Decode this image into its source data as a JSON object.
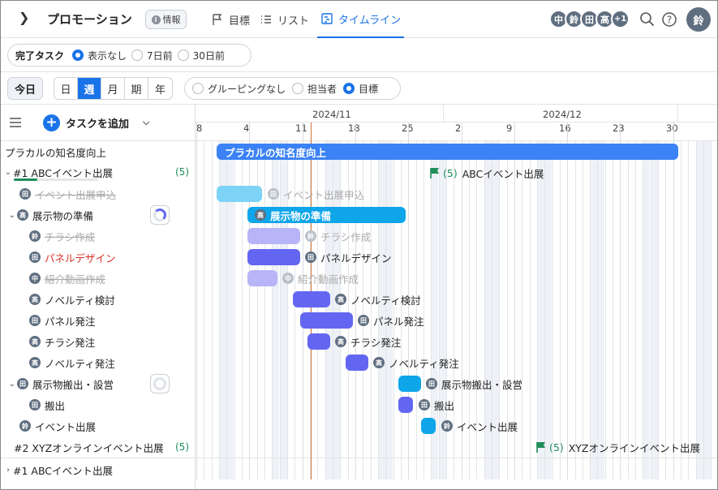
{
  "header": {
    "title": "プロモーション",
    "info_label": "情報",
    "tabs": [
      {
        "label": "目標",
        "icon": "flag-icon"
      },
      {
        "label": "リスト",
        "icon": "list-icon"
      },
      {
        "label": "タイムライン",
        "icon": "timeline-icon",
        "active": true
      }
    ],
    "avatars": [
      "中",
      "鈴",
      "田",
      "高",
      "+1"
    ],
    "user_avatar": "鈴"
  },
  "filters": {
    "completed_label": "完了タスク",
    "completed_options": [
      "表示なし",
      "7日前",
      "30日前"
    ],
    "completed_selected": "表示なし",
    "today_label": "今日",
    "scales": [
      "日",
      "週",
      "月",
      "期",
      "年"
    ],
    "scale_selected": "週",
    "grouping_options": [
      "グルーピングなし",
      "担当者",
      "目標"
    ],
    "grouping_selected": "目標"
  },
  "sidebar": {
    "add_task_label": "タスクを追加",
    "rows": [
      {
        "label": "プラカルの知名度向上"
      },
      {
        "label": "#1 ABCイベント出展",
        "count": "(5)"
      },
      {
        "label": "イベント出展申込",
        "avatar": "田"
      },
      {
        "label": "展示物の準備",
        "avatar": "高"
      },
      {
        "label": "チラシ作成",
        "avatar": "鈴"
      },
      {
        "label": "パネルデザイン",
        "avatar": "田"
      },
      {
        "label": "紹介動画作成",
        "avatar": "中"
      },
      {
        "label": "ノベルティ検討",
        "avatar": "高"
      },
      {
        "label": "パネル発注",
        "avatar": "田"
      },
      {
        "label": "チラシ発注",
        "avatar": "高"
      },
      {
        "label": "ノベルティ発注",
        "avatar": "高"
      },
      {
        "label": "展示物搬出・設営",
        "avatar": "田"
      },
      {
        "label": "搬出",
        "avatar": "田"
      },
      {
        "label": "イベント出展",
        "avatar": "鈴"
      },
      {
        "label": "#2 XYZオンラインイベント出展",
        "count": "(5)"
      },
      {
        "label": "#1 ABCイベント出展"
      }
    ]
  },
  "timeline": {
    "months": [
      "2024/11",
      "2024/12"
    ],
    "ticks": [
      "8",
      "4",
      "11",
      "18",
      "25",
      "2",
      "9",
      "16",
      "23",
      "30"
    ],
    "goal_bar_label": "プラカルの知名度向上",
    "milestones": [
      {
        "count": "(5)",
        "label": "ABCイベント出展"
      },
      {
        "count": "(5)",
        "label": "XYZオンラインイベント出展"
      }
    ],
    "bars": [
      {
        "label": "イベント出展申込",
        "avatar": "田"
      },
      {
        "label": "展示物の準備",
        "avatar": "高"
      },
      {
        "label": "チラシ作成",
        "avatar": "鈴"
      },
      {
        "label": "パネルデザイン",
        "avatar": "田"
      },
      {
        "label": "紹介動画作成",
        "avatar": "中"
      },
      {
        "label": "ノベルティ検討",
        "avatar": "高"
      },
      {
        "label": "パネル発注",
        "avatar": "田"
      },
      {
        "label": "チラシ発注",
        "avatar": "高"
      },
      {
        "label": "ノベルティ発注",
        "avatar": "高"
      },
      {
        "label": "展示物搬出・設営",
        "avatar": "田"
      },
      {
        "label": "搬出",
        "avatar": "田"
      },
      {
        "label": "イベント出展",
        "avatar": "鈴"
      }
    ]
  },
  "colors": {
    "accent": "#1a73e8",
    "goal_bar": "#3b82f6",
    "group_bar": "#0ea5e9",
    "task_bar": "#6366f1",
    "today_line": "#d0783c",
    "milestone": "#1e8e5a"
  }
}
